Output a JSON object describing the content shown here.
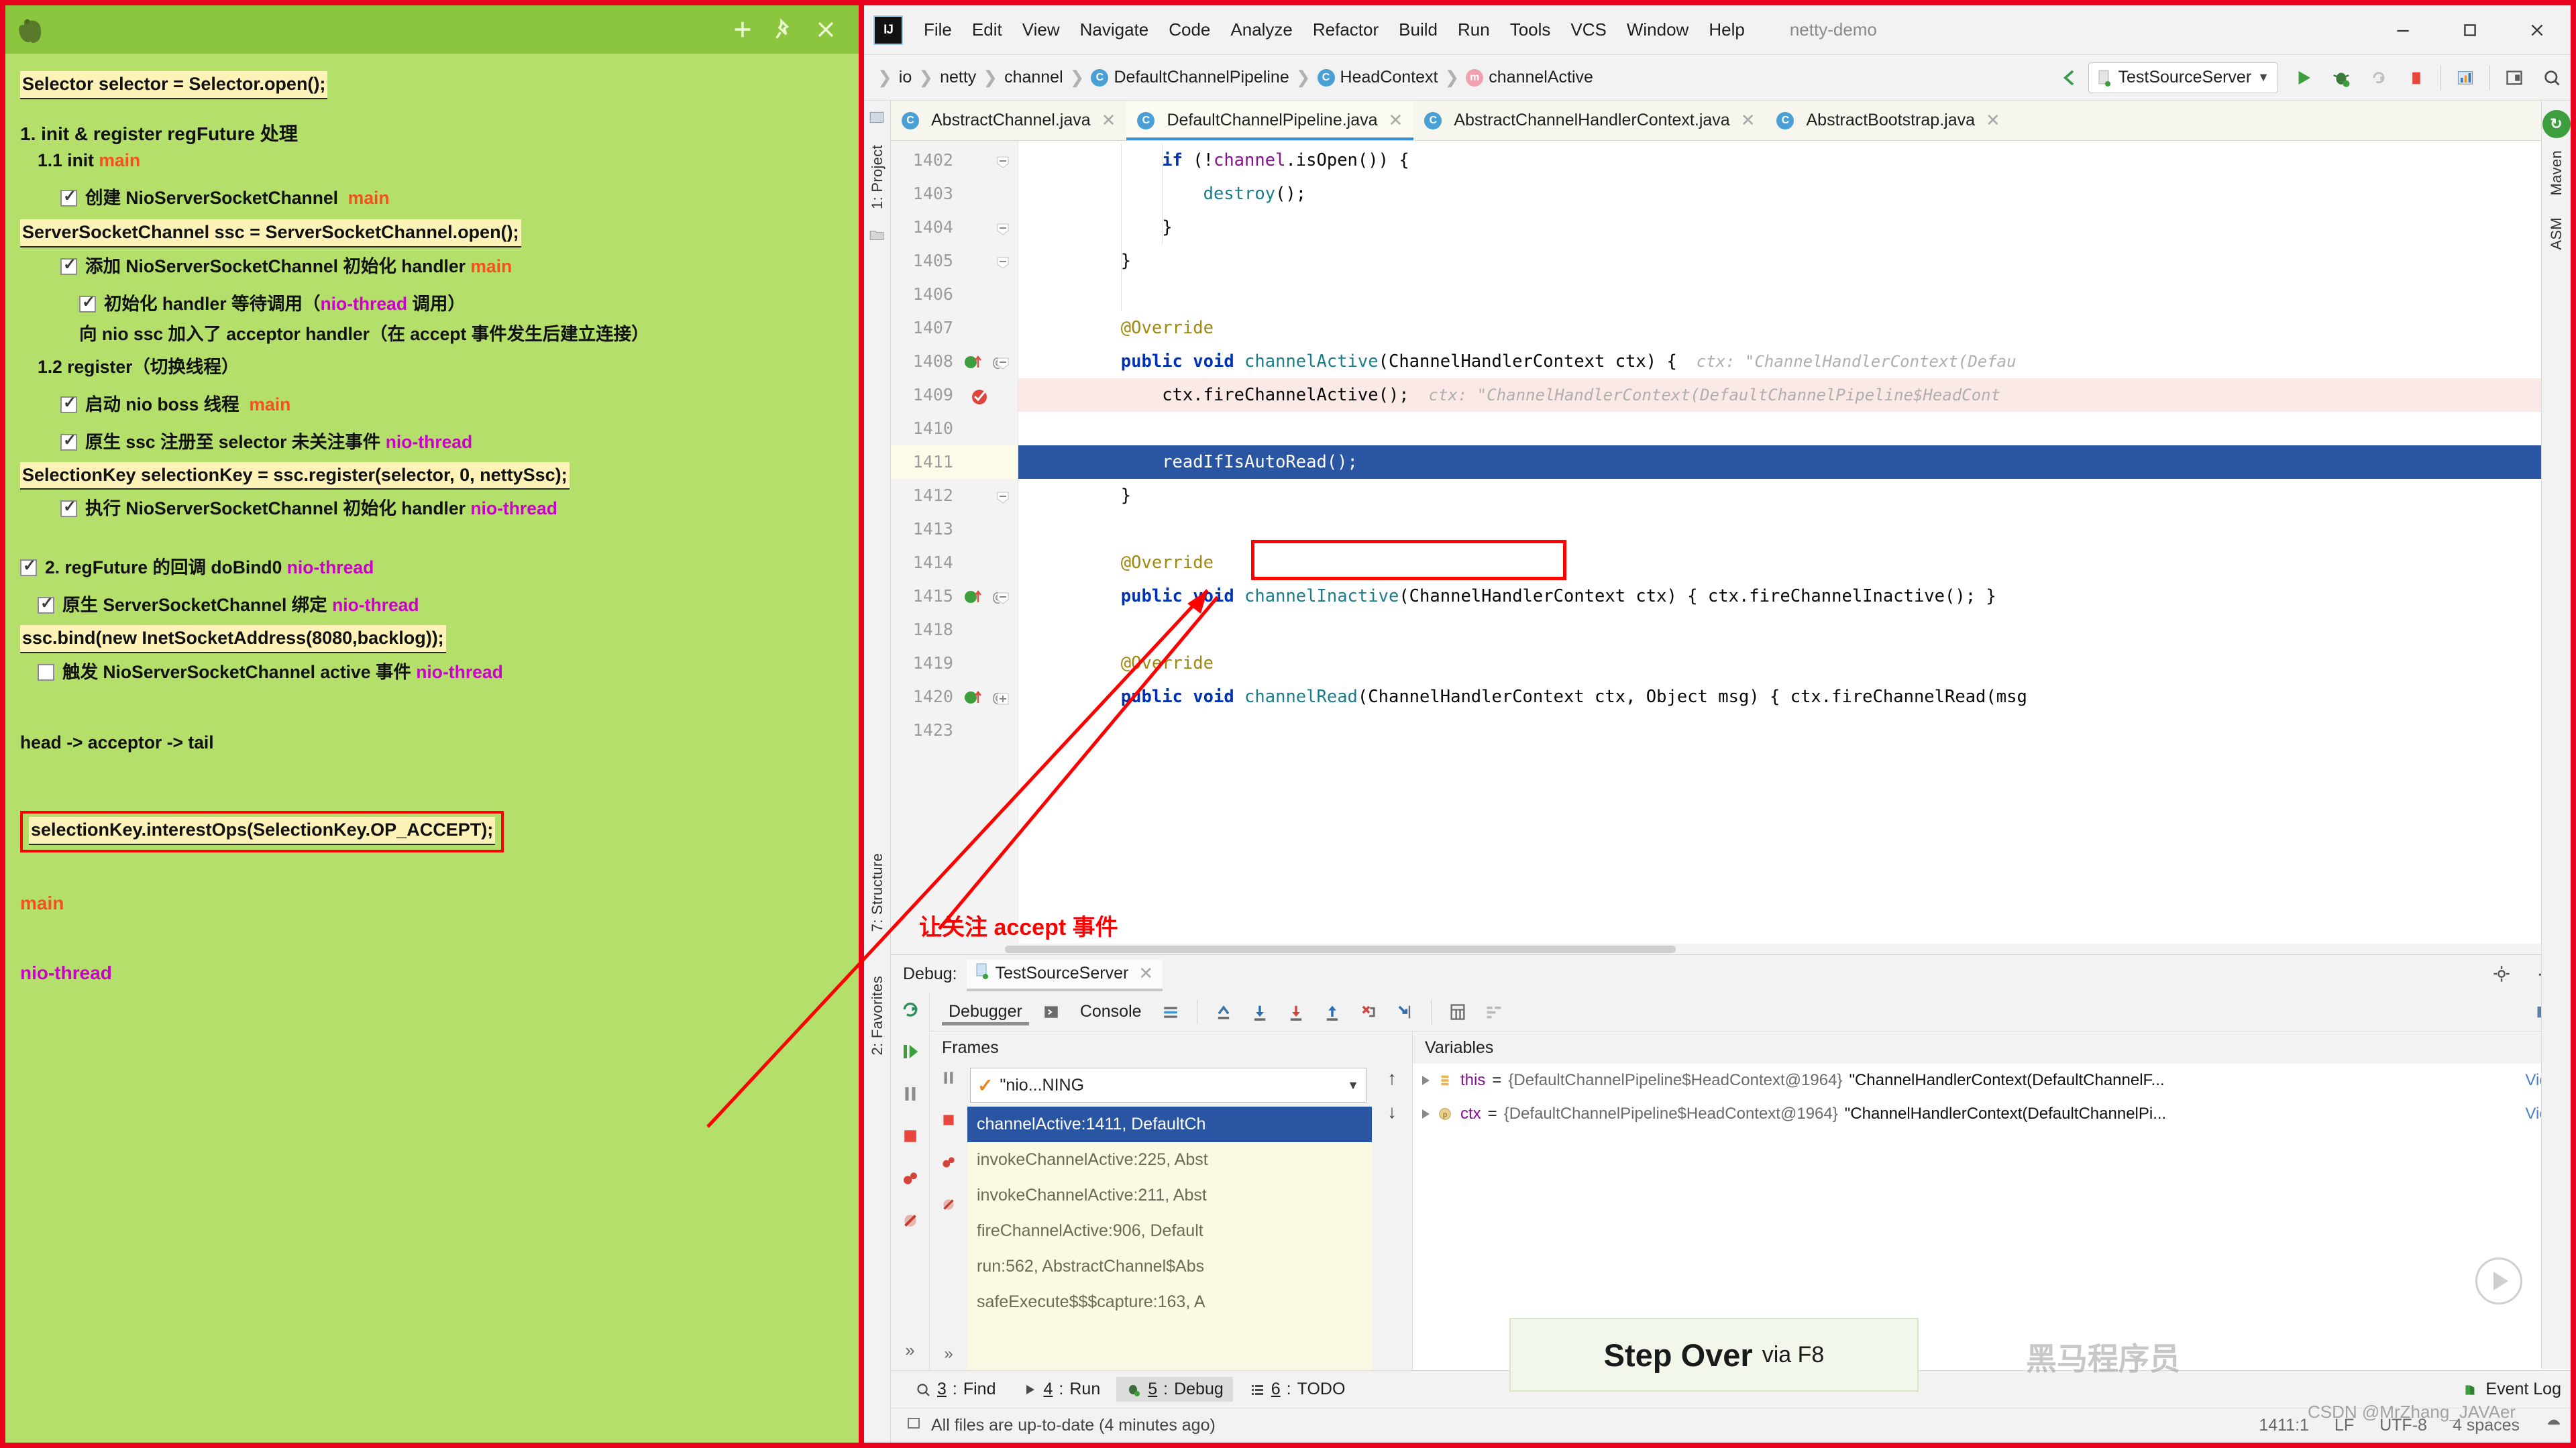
{
  "note": {
    "app_icon": "evernote-elephant-icon",
    "titlebar_buttons": [
      {
        "name": "add-note-button",
        "glyph": "+"
      },
      {
        "name": "pin-note-button",
        "glyph": "pin-icon"
      },
      {
        "name": "close-note-button",
        "glyph": "×"
      }
    ],
    "lines": [
      {
        "type": "code",
        "text": "Selector selector = Selector.open();"
      },
      {
        "type": "gap-m"
      },
      {
        "type": "heading",
        "text": "1. init & register regFuture 处理"
      },
      {
        "type": "sub",
        "indent": 1,
        "text": "1.1 init ",
        "tag": "main",
        "tagcolor": "red"
      },
      {
        "type": "gap-s"
      },
      {
        "type": "check",
        "indent": 2,
        "checked": true,
        "text": "创建 NioServerSocketChannel",
        "tag": "main",
        "tagcolor": "red"
      },
      {
        "type": "code",
        "text": "ServerSocketChannel ssc = ServerSocketChannel.open();"
      },
      {
        "type": "check",
        "indent": 2,
        "checked": true,
        "text": "添加 NioServerSocketChannel 初始化 handler",
        "tag": "main",
        "tagcolor": "red"
      },
      {
        "type": "gap-s"
      },
      {
        "type": "check",
        "indent": 3,
        "checked": true,
        "text": "初始化 handler 等待调用（",
        "tag": "nio-thread",
        "tagcolor": "purple",
        "suffix": " 调用）"
      },
      {
        "type": "plain-wrap",
        "indent": 3,
        "text": "向 nio ssc 加入了 acceptor handler（在 accept 事件发生后建立连接）"
      },
      {
        "type": "sub",
        "indent": 1,
        "text": "1.2 register（切换线程）"
      },
      {
        "type": "gap-s"
      },
      {
        "type": "check",
        "indent": 2,
        "checked": true,
        "text": "启动 nio boss 线程",
        "tag": "main",
        "tagcolor": "red"
      },
      {
        "type": "gap-s"
      },
      {
        "type": "check",
        "indent": 2,
        "checked": true,
        "text": "原生 ssc 注册至 selector 未关注事件",
        "tag": "nio-thread",
        "tagcolor": "purple"
      },
      {
        "type": "code",
        "text": "SelectionKey selectionKey = ssc.register(selector, 0, nettySsc);"
      },
      {
        "type": "check",
        "indent": 2,
        "checked": true,
        "text": "执行 NioServerSocketChannel 初始化 handler",
        "tag": "nio-thread",
        "tagcolor": "purple"
      },
      {
        "type": "gap-l"
      },
      {
        "type": "check",
        "indent": 0,
        "checked": true,
        "text": "2. regFuture 的回调 doBind0",
        "tag": "nio-thread",
        "tagcolor": "purple"
      },
      {
        "type": "gap-s"
      },
      {
        "type": "check",
        "indent": 1,
        "checked": true,
        "text": "原生 ServerSocketChannel 绑定",
        "tag": "nio-thread",
        "tagcolor": "purple"
      },
      {
        "type": "code",
        "text": "ssc.bind(new InetSocketAddress(8080,backlog));"
      },
      {
        "type": "check",
        "indent": 1,
        "checked": false,
        "text": "触发 NioServerSocketChannel active 事件",
        "tag": "nio-thread",
        "tagcolor": "purple"
      },
      {
        "type": "gap-l"
      },
      {
        "type": "plain",
        "text": "head -> acceptor -> tail"
      },
      {
        "type": "gap-l"
      },
      {
        "type": "code-boxed",
        "text": "selectionKey.interestOps(SelectionKey.OP_ACCEPT);"
      },
      {
        "type": "gap-m"
      },
      {
        "type": "legend",
        "text": "main",
        "color": "red"
      },
      {
        "type": "gap-m"
      },
      {
        "type": "legend",
        "text": "nio-thread",
        "color": "purple"
      }
    ],
    "legend": {
      "main": "main",
      "nio_thread": "nio-thread"
    },
    "colors": {
      "bg": "#b4df6a",
      "titlebar": "#8cc63e",
      "highlight": "#fdf3b8",
      "main_tag": "#f4511e",
      "nio_tag": "#cc00cc"
    }
  },
  "ide": {
    "logo_text": "IJ",
    "project_name": "netty-demo",
    "menu": [
      "File",
      "Edit",
      "View",
      "Navigate",
      "Code",
      "Analyze",
      "Refactor",
      "Build",
      "Run",
      "Tools",
      "VCS",
      "Window",
      "Help"
    ],
    "window_buttons": [
      {
        "name": "minimize-button",
        "glyph": "–"
      },
      {
        "name": "maximize-button",
        "glyph": "□"
      },
      {
        "name": "close-button",
        "glyph": "✕"
      }
    ],
    "breadcrumb": [
      {
        "label": "io",
        "icon": ""
      },
      {
        "label": "netty",
        "icon": ""
      },
      {
        "label": "channel",
        "icon": ""
      },
      {
        "label": "DefaultChannelPipeline",
        "icon": "class-icon"
      },
      {
        "label": "HeadContext",
        "icon": "class-icon"
      },
      {
        "label": "channelActive",
        "icon": "method-icon"
      }
    ],
    "run_config": "TestSourceServer",
    "toolbar_icons": [
      "back-arrow-icon",
      "run-icon",
      "debug-icon",
      "rerun-icon",
      "stop-icon",
      "coverage-icon",
      "show-console-icon",
      "search-everywhere-icon"
    ],
    "tabs": [
      {
        "label": "AbstractChannel.java",
        "active": false
      },
      {
        "label": "DefaultChannelPipeline.java",
        "active": true
      },
      {
        "label": "AbstractChannelHandlerContext.java",
        "active": false
      },
      {
        "label": "AbstractBootstrap.java",
        "active": false
      }
    ],
    "left_strip": [
      "1: Project",
      "7: Structure",
      "2: Favorites"
    ],
    "right_strip": [
      "Maven",
      "ASM"
    ],
    "editor": {
      "lines": [
        {
          "num": "1402",
          "fold": "collapse",
          "indent": 3,
          "tokens": [
            {
              "t": "kw",
              "v": "if"
            },
            {
              "t": "plain",
              "v": " (!"
            },
            {
              "t": "fld",
              "v": "channel"
            },
            {
              "t": "plain",
              "v": ".isOpen()) {"
            }
          ]
        },
        {
          "num": "1403",
          "indent": 4,
          "tokens": [
            {
              "t": "mcall",
              "v": "destroy"
            },
            {
              "t": "plain",
              "v": "();"
            }
          ]
        },
        {
          "num": "1404",
          "fold": "collapse",
          "indent": 3,
          "tokens": [
            {
              "t": "plain",
              "v": "}"
            }
          ]
        },
        {
          "num": "1405",
          "fold": "collapse",
          "indent": 2,
          "tokens": [
            {
              "t": "plain",
              "v": "}"
            }
          ]
        },
        {
          "num": "1406",
          "indent": 0,
          "tokens": []
        },
        {
          "num": "1407",
          "indent": 2,
          "tokens": [
            {
              "t": "ann",
              "v": "@Override"
            }
          ]
        },
        {
          "num": "1408",
          "gutter": "breakpoint-and-override",
          "fold": "collapse",
          "indent": 2,
          "tokens": [
            {
              "t": "kw",
              "v": "public void "
            },
            {
              "t": "mcall",
              "v": "channelActive"
            },
            {
              "t": "plain",
              "v": "(ChannelHandlerContext ctx) {"
            },
            {
              "t": "hint",
              "v": "  ctx: \"ChannelHandlerContext(Defau"
            }
          ]
        },
        {
          "num": "1409",
          "gutter": "current-line-arrow",
          "highlight": "pink",
          "indent": 3,
          "tokens": [
            {
              "t": "plain",
              "v": "ctx.fireChannelActive();"
            },
            {
              "t": "hint",
              "v": "  ctx: \"ChannelHandlerContext(DefaultChannelPipeline$HeadCont"
            }
          ]
        },
        {
          "num": "1410",
          "indent": 0,
          "tokens": []
        },
        {
          "num": "1411",
          "highlight": "blue-selected",
          "indent": 3,
          "boxed": true,
          "tokens": [
            {
              "t": "plain",
              "v": "readIfIsAutoRead();"
            }
          ]
        },
        {
          "num": "1412",
          "fold": "collapse",
          "indent": 2,
          "tokens": [
            {
              "t": "plain",
              "v": "}"
            }
          ]
        },
        {
          "num": "1413",
          "indent": 0,
          "tokens": []
        },
        {
          "num": "1414",
          "indent": 2,
          "tokens": [
            {
              "t": "ann",
              "v": "@Override"
            }
          ]
        },
        {
          "num": "1415",
          "gutter": "breakpoint-and-override",
          "fold": "collapse",
          "indent": 2,
          "tokens": [
            {
              "t": "kw",
              "v": "public void "
            },
            {
              "t": "mcall",
              "v": "channelInactive"
            },
            {
              "t": "plain",
              "v": "(ChannelHandlerContext ctx) { ctx.fireChannelInactive(); }"
            }
          ]
        },
        {
          "num": "1418",
          "indent": 0,
          "tokens": []
        },
        {
          "num": "1419",
          "indent": 2,
          "tokens": [
            {
              "t": "ann",
              "v": "@Override"
            }
          ]
        },
        {
          "num": "1420",
          "gutter": "breakpoint-and-override",
          "fold": "expand",
          "indent": 2,
          "tokens": [
            {
              "t": "kw",
              "v": "public void "
            },
            {
              "t": "mcall",
              "v": "channelRead"
            },
            {
              "t": "plain",
              "v": "(ChannelHandlerContext ctx, Object msg) { ctx.fireChannelRead(msg"
            }
          ]
        },
        {
          "num": "1423",
          "indent": 0,
          "tokens": []
        }
      ]
    },
    "debug": {
      "title": "Debug:",
      "session_tab": "TestSourceServer",
      "view_tabs": [
        {
          "label": "Debugger",
          "selected": true
        },
        {
          "label": "Console",
          "selected": false
        }
      ],
      "stepping_icons": [
        "step-over-icon",
        "step-into-icon",
        "force-step-into-icon",
        "step-out-icon",
        "drop-frame-icon",
        "run-to-cursor-icon",
        "evaluate-expression-icon",
        "layout-icon"
      ],
      "frames_title": "Frames",
      "variables_title": "Variables",
      "thread_selector": "\"nio...NING",
      "frames": [
        {
          "label": "channelActive:1411, DefaultCh",
          "selected": true
        },
        {
          "label": "invokeChannelActive:225, Abst",
          "selected": false
        },
        {
          "label": "invokeChannelActive:211, Abst",
          "selected": false
        },
        {
          "label": "fireChannelActive:906, Default",
          "selected": false
        },
        {
          "label": "run:562, AbstractChannel$Abs",
          "selected": false
        },
        {
          "label": "safeExecute$$$capture:163, A",
          "selected": false
        }
      ],
      "variables": [
        {
          "icon": "field-icon",
          "name": "this",
          "eq": "=",
          "type": "{DefaultChannelPipeline$HeadContext@1964}",
          "value": "\"ChannelHandlerContext(DefaultChannelF...",
          "view": "View"
        },
        {
          "icon": "parameter-icon",
          "name": "ctx",
          "eq": "=",
          "type": "{DefaultChannelPipeline$HeadContext@1964}",
          "value": "\"ChannelHandlerContext(DefaultChannelPi...",
          "view": "View"
        }
      ]
    },
    "bottom_tabs": [
      {
        "num": "3",
        "label": "Find",
        "icon": "search-icon",
        "active": false
      },
      {
        "num": "4",
        "label": "Run",
        "icon": "run-icon",
        "active": false
      },
      {
        "num": "5",
        "label": "Debug",
        "icon": "debug-icon",
        "active": true
      },
      {
        "num": "6",
        "label": "TODO",
        "icon": "todo-icon",
        "active": false
      }
    ],
    "event_log": "Event Log",
    "statusbar": {
      "message": "All files are up-to-date (4 minutes ago)",
      "caret": "1411:1",
      "line_separator": "LF",
      "encoding": "UTF-8",
      "indent": "4 spaces"
    }
  },
  "annotations": {
    "accept_note": "让关注 accept 事件",
    "step_over_strong": "Step Over",
    "step_over_rest": "via F8",
    "watermark": "黑马程序员",
    "watermark_small": "CSDN @MrZhang_JAVAer"
  }
}
